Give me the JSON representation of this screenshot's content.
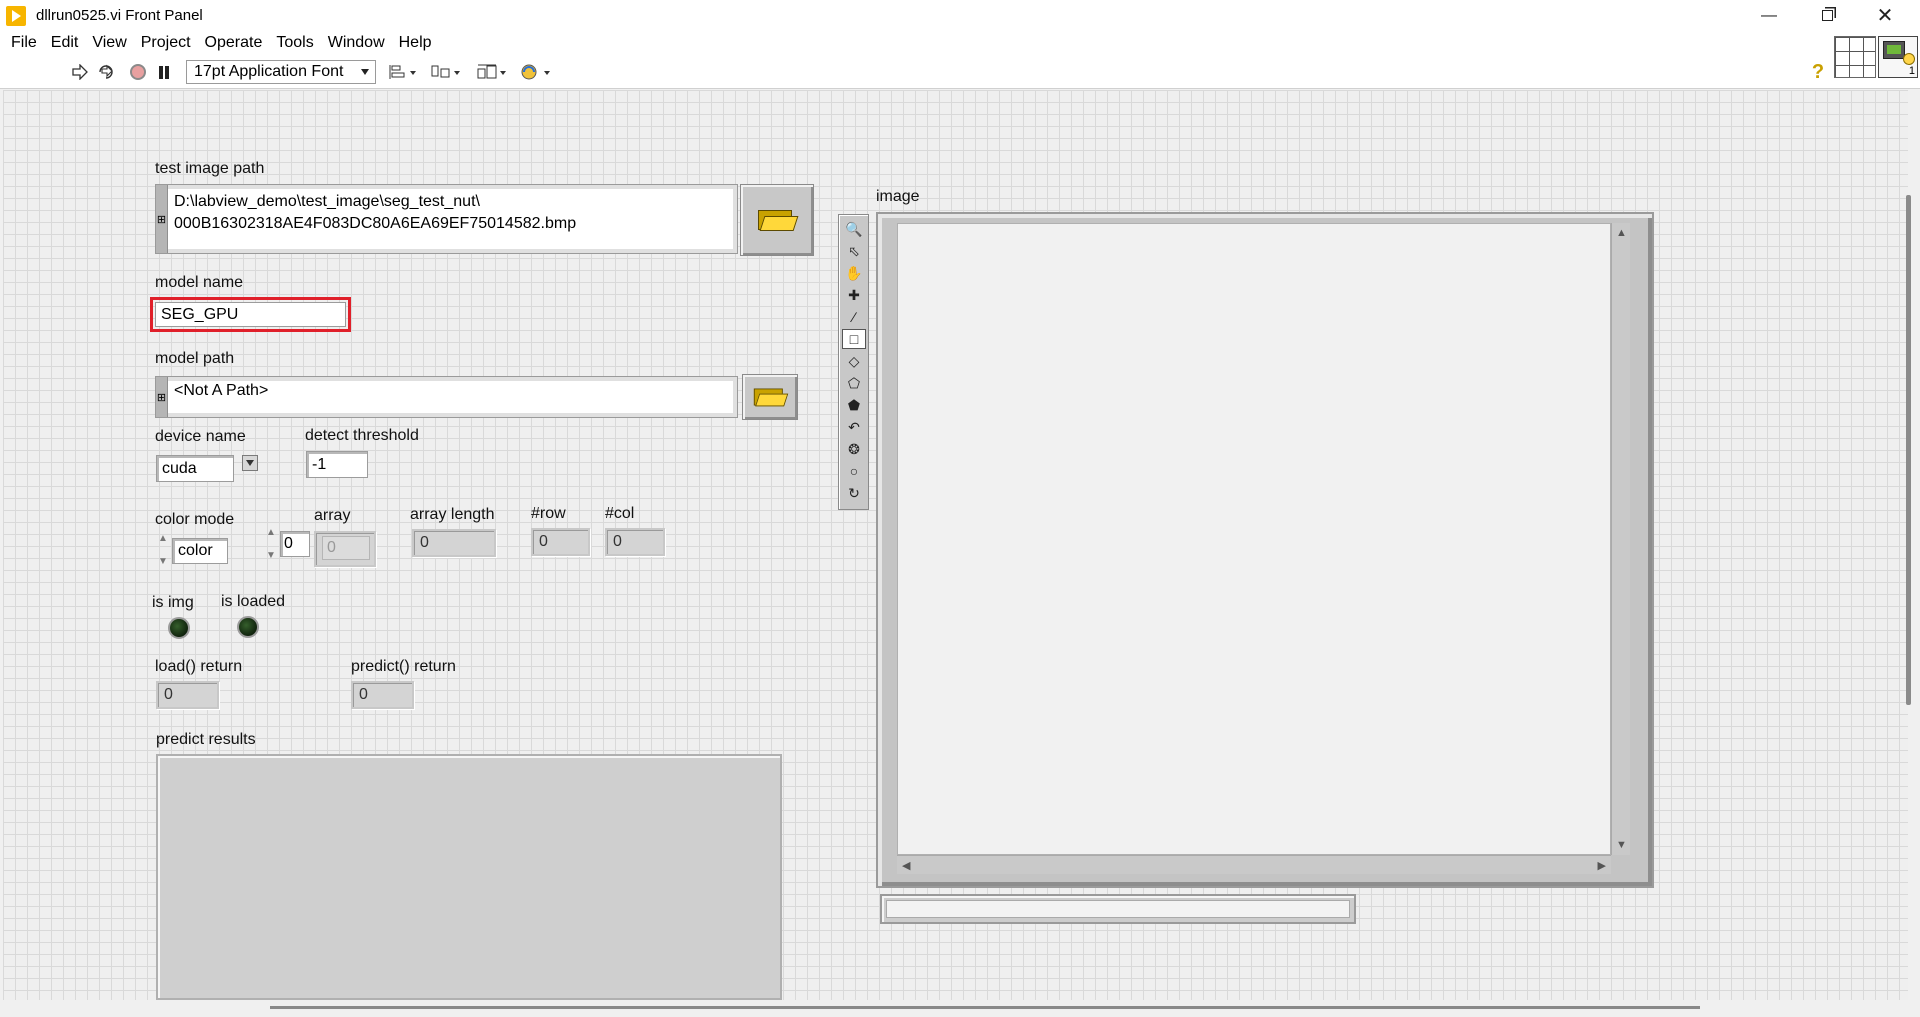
{
  "window": {
    "title": "dllrun0525.vi Front Panel",
    "minimize_icon": "minimize-icon",
    "restore_icon": "restore-icon",
    "close_icon": "close-icon"
  },
  "menu": {
    "items": [
      "File",
      "Edit",
      "View",
      "Project",
      "Operate",
      "Tools",
      "Window",
      "Help"
    ]
  },
  "toolbar": {
    "font": "17pt Application Font",
    "help_glyph": "?"
  },
  "test_image_path": {
    "label": "test image path",
    "line1": "D:\\labview_demo\\test_image\\seg_test_nut\\",
    "line2": "000B16302318AE4F083DC80A6EA69EF75014582.bmp"
  },
  "model_name": {
    "label": "model name",
    "value": "SEG_GPU"
  },
  "model_path": {
    "label": "model path",
    "value": "<Not A Path>"
  },
  "device_name": {
    "label": "device name",
    "value": "cuda"
  },
  "detect_threshold": {
    "label": "detect threshold",
    "value": "-1"
  },
  "color_mode": {
    "label": "color mode",
    "value": "color"
  },
  "array": {
    "label": "array",
    "index": "0",
    "value": "0"
  },
  "array_length": {
    "label": "array length",
    "value": "0"
  },
  "row": {
    "label": "#row",
    "value": "0"
  },
  "col": {
    "label": "#col",
    "value": "0"
  },
  "is_img": {
    "label": "is img"
  },
  "is_loaded": {
    "label": "is loaded"
  },
  "load_return": {
    "label": "load() return",
    "value": "0"
  },
  "predict_return": {
    "label": "predict() return",
    "value": "0"
  },
  "predict_results": {
    "label": "predict results"
  },
  "image": {
    "label": "image"
  },
  "colors": {
    "highlight": "#e0202a",
    "led_off": "#1e3a18",
    "panel_grid": "#d9d9d9"
  }
}
